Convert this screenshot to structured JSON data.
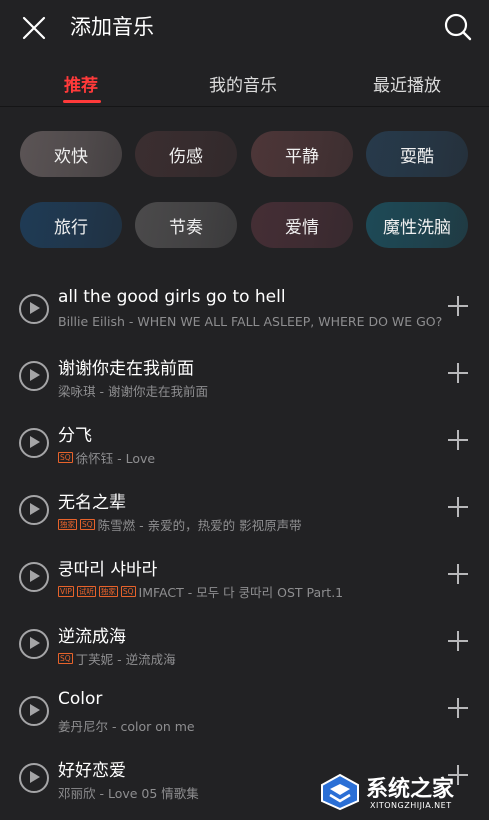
{
  "header": {
    "title": "添加音乐"
  },
  "tabs": [
    {
      "label": "推荐"
    },
    {
      "label": "我的音乐"
    },
    {
      "label": "最近播放"
    }
  ],
  "categories": [
    {
      "label": "欢快",
      "color": "#5b5455"
    },
    {
      "label": "伤感",
      "color": "#3b2e30"
    },
    {
      "label": "平静",
      "color": "#4d3638"
    },
    {
      "label": "耍酷",
      "color": "#273a4b"
    },
    {
      "label": "旅行",
      "color": "#1f3b55"
    },
    {
      "label": "节奏",
      "color": "#4b4a4b"
    },
    {
      "label": "爱情",
      "color": "#452e35"
    },
    {
      "label": "魔性洗脑",
      "color": "#1e4a57"
    }
  ],
  "songs": [
    {
      "title": "all the good girls go to hell",
      "badges": [],
      "subtitle": "Billie Eilish - WHEN WE ALL FALL ASLEEP, WHERE DO WE GO?"
    },
    {
      "title": "谢谢你走在我前面",
      "badges": [],
      "subtitle": "梁咏琪 - 谢谢你走在我前面"
    },
    {
      "title": "分飞",
      "badges": [
        "SQ"
      ],
      "subtitle": "徐怀钰 - Love"
    },
    {
      "title": "无名之辈",
      "badges": [
        "独家",
        "SQ"
      ],
      "subtitle": "陈雪燃 - 亲爱的，热爱的 影视原声带"
    },
    {
      "title": "쿵따리 샤바라",
      "badges": [
        "VIP",
        "试听",
        "独家",
        "SQ"
      ],
      "subtitle": "IMFACT - 모두 다 쿵따리 OST Part.1"
    },
    {
      "title": "逆流成海",
      "badges": [
        "SQ"
      ],
      "subtitle": "丁芙妮 - 逆流成海"
    },
    {
      "title": "Color",
      "badges": [],
      "subtitle": "姜丹尼尔 - color on me"
    },
    {
      "title": "好好恋爱",
      "badges": [],
      "subtitle": "邓丽欣 - Love 05 情歌集"
    }
  ],
  "watermark": {
    "text": "系统之家",
    "sub": "XITONGZHIJIA.NET"
  },
  "colors": {
    "accent": "#ff3a3a",
    "background": "#222224",
    "badge": "#e8632b"
  }
}
